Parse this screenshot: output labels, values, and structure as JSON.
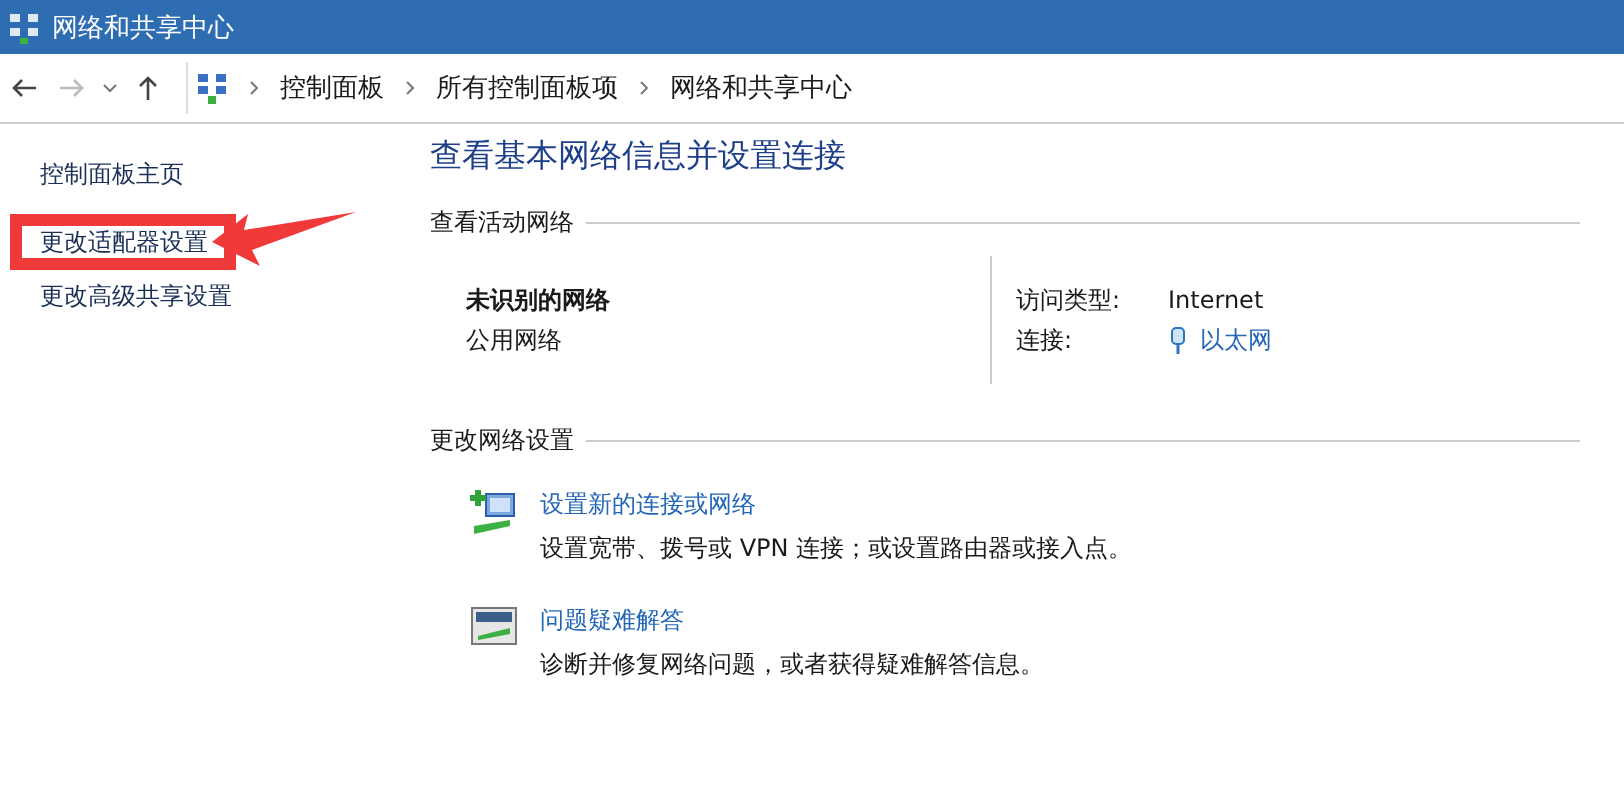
{
  "window": {
    "title": "网络和共享中心"
  },
  "breadcrumb": [
    "控制面板",
    "所有控制面板项",
    "网络和共享中心"
  ],
  "sidebar": {
    "items": [
      {
        "label": "控制面板主页"
      },
      {
        "label": "更改适配器设置"
      },
      {
        "label": "更改高级共享设置"
      }
    ]
  },
  "heading": "查看基本网络信息并设置连接",
  "active_networks": {
    "title": "查看活动网络",
    "name": "未识别的网络",
    "category": "公用网络",
    "access_type_label": "访问类型:",
    "access_type": "Internet",
    "connection_label": "连接:",
    "connection": "以太网"
  },
  "change_settings": {
    "title": "更改网络设置",
    "items": [
      {
        "kind": "new-connection",
        "link": "设置新的连接或网络",
        "description": "设置宽带、拨号或 VPN 连接；或设置路由器或接入点。"
      },
      {
        "kind": "troubleshoot",
        "link": "问题疑难解答",
        "description": "诊断并修复网络问题，或者获得疑难解答信息。"
      }
    ]
  }
}
